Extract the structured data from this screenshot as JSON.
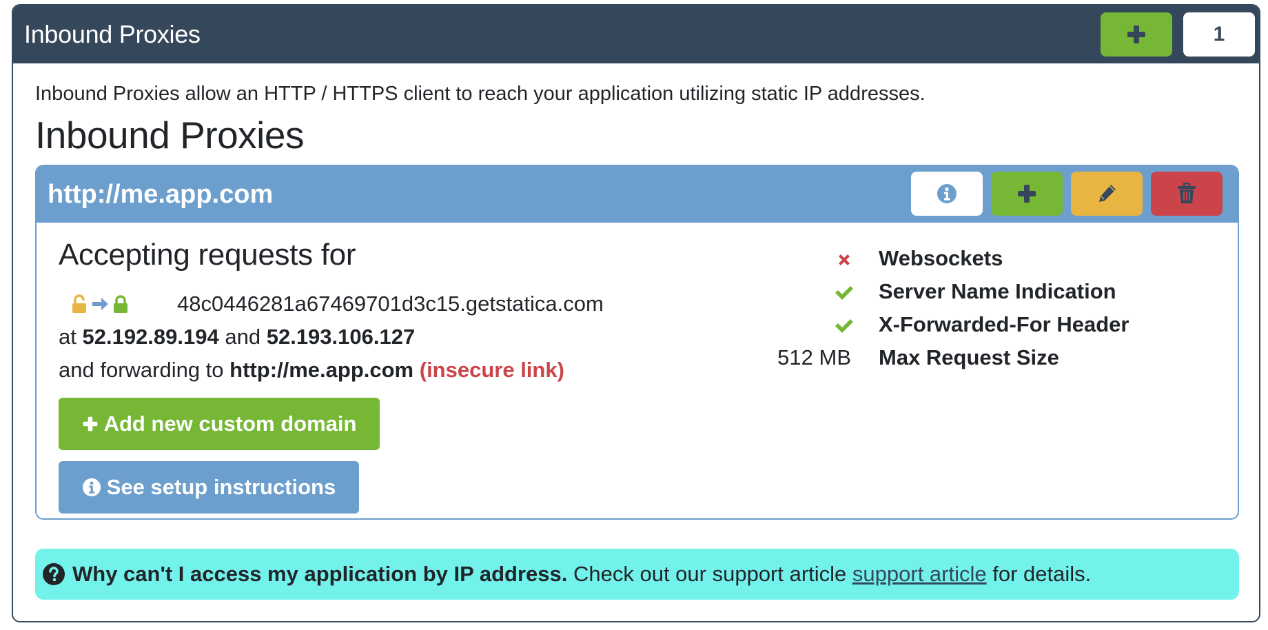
{
  "panel": {
    "title": "Inbound Proxies",
    "add_button_icon": "plus-icon",
    "count": "1",
    "description": "Inbound Proxies allow an HTTP / HTTPS client to reach your application utilizing static IP addresses.",
    "heading": "Inbound Proxies"
  },
  "proxy": {
    "title": "http://me.app.com",
    "actions": [
      {
        "name": "info",
        "icon": "info-circle-icon"
      },
      {
        "name": "add",
        "icon": "plus-icon"
      },
      {
        "name": "edit",
        "icon": "pencil-icon"
      },
      {
        "name": "delete",
        "icon": "trash-icon"
      }
    ],
    "accepting_title": "Accepting requests for",
    "tls_icons": [
      "unlock-icon",
      "arrow-right-icon",
      "lock-icon"
    ],
    "domain": "48c0446281a67469701d3c15.getstatica.com",
    "ips_prefix": "at",
    "ip1": "52.192.89.194",
    "ips_joiner": "and",
    "ip2": "52.193.106.127",
    "forward_prefix": "and forwarding to",
    "forward_target": "http://me.app.com",
    "insecure_label": "(insecure link)",
    "add_domain_button": "Add new custom domain",
    "setup_button": "See setup instructions",
    "features": [
      {
        "label": "Websockets",
        "status": "disabled",
        "icon": "x-icon"
      },
      {
        "label": "Server Name Indication",
        "status": "enabled",
        "icon": "check-icon"
      },
      {
        "label": "X-Forwarded-For Header",
        "status": "enabled",
        "icon": "check-icon"
      },
      {
        "label": "Max Request Size",
        "value": "512 MB"
      }
    ]
  },
  "alert": {
    "bold": "Why can't I access my application by IP address.",
    "text": "Check out our support article",
    "link": "support article",
    "suffix": "for details."
  },
  "colors": {
    "header_bg": "#35475a",
    "success": "#76b736",
    "primary": "#6c9fcd",
    "warning": "#e8b542",
    "danger": "#cb444a",
    "info_alert": "#72f2ea"
  }
}
